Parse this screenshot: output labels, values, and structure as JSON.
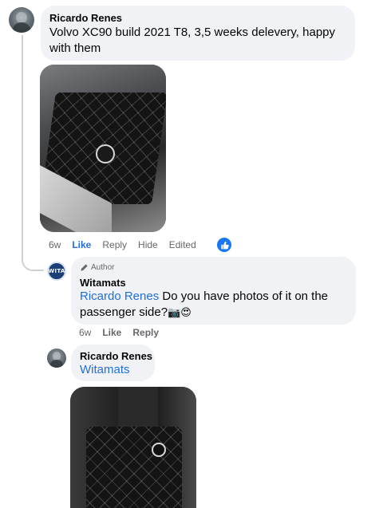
{
  "comments": [
    {
      "author": "Ricardo Renes",
      "text": "Volvo XC90 build 2021 T8, 3,5 weeks delevery, happy with them",
      "actions": {
        "time": "6w",
        "like": "Like",
        "reply": "Reply",
        "hide": "Hide",
        "edited": "Edited"
      }
    },
    {
      "badge": "Author",
      "author": "Witamats",
      "mention": "Ricardo Renes",
      "text": " Do you have photos of it on the passenger side?",
      "emoji": "📷😍",
      "actions": {
        "time": "6w",
        "like": "Like",
        "reply": "Reply"
      }
    },
    {
      "author": "Ricardo Renes",
      "mention": "Witamats"
    }
  ],
  "icons": {
    "reaction": "thumbs-up-icon",
    "badge": "pencil-icon",
    "avatar_brand_text": "WITA"
  },
  "colors": {
    "link": "#216fdb",
    "bubble": "#f0f2f5",
    "meta": "#65676b",
    "like_reaction": "#1877f2"
  }
}
